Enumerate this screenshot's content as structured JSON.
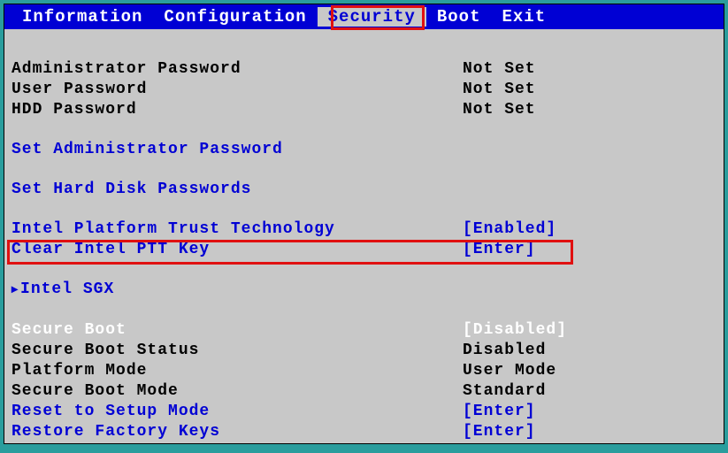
{
  "menu": {
    "items": [
      "Information",
      "Configuration",
      "Security",
      "Boot",
      "Exit"
    ],
    "active_index": 2
  },
  "security": {
    "admin_password": {
      "label": "Administrator Password",
      "value": "Not Set"
    },
    "user_password": {
      "label": "User Password",
      "value": "Not Set"
    },
    "hdd_password": {
      "label": "HDD Password",
      "value": "Not Set"
    },
    "set_admin_password": {
      "label": "Set Administrator Password"
    },
    "set_hdd_passwords": {
      "label": "Set Hard Disk Passwords"
    },
    "intel_ptt": {
      "label": "Intel Platform Trust Technology",
      "value": "[Enabled]"
    },
    "clear_ptt_key": {
      "label": "Clear Intel PTT Key",
      "value": "[Enter]"
    },
    "intel_sgx": {
      "label": "Intel SGX"
    },
    "secure_boot": {
      "label": "Secure Boot",
      "value": "[Disabled]"
    },
    "secure_boot_status": {
      "label": "Secure Boot Status",
      "value": "Disabled"
    },
    "platform_mode": {
      "label": "Platform Mode",
      "value": "User Mode"
    },
    "secure_boot_mode": {
      "label": "Secure Boot Mode",
      "value": "Standard"
    },
    "reset_setup_mode": {
      "label": "Reset to Setup Mode",
      "value": "[Enter]"
    },
    "restore_factory_keys": {
      "label": "Restore Factory Keys",
      "value": "[Enter]"
    }
  }
}
